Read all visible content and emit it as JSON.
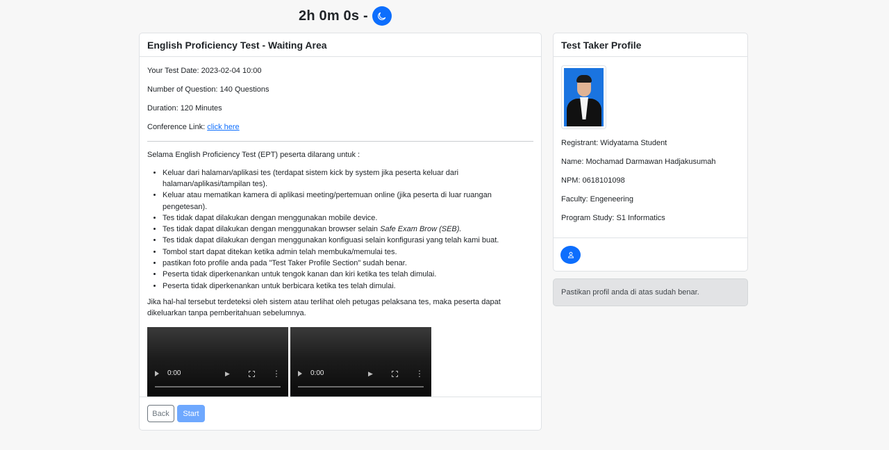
{
  "timer": {
    "text": "2h 0m 0s -"
  },
  "icons": {
    "theme_toggle": "moon-icon",
    "profile_button": "user-icon"
  },
  "colors": {
    "primary": "#0d6efd",
    "start_button": "#6ea8fe",
    "background": "#f7f7f7",
    "alert_background": "#e2e3e5"
  },
  "main": {
    "title": "English Proficiency Test - Waiting Area",
    "test_date": "Your Test Date: 2023-02-04 10:00",
    "questions": "Number of Question: 140 Questions",
    "duration": "Duration: 120 Minutes",
    "conference_label": "Conference Link: ",
    "conference_link": "click here",
    "rules_intro": "Selama English Proficiency Test (EPT) peserta dilarang untuk :",
    "rules": [
      "Keluar dari halaman/aplikasi tes (terdapat sistem kick by system jika peserta keluar dari halaman/aplikasi/tampilan tes).",
      "Keluar atau mematikan kamera di aplikasi meeting/pertemuan online (jika peserta di luar ruangan pengetesan).",
      "Tes tidak dapat dilakukan dengan menggunakan mobile device.",
      "Tes tidak dapat dilakukan dengan menggunakan browser selain ",
      "Tes tidak dapat dilakukan dengan menggunakan konfiguasi selain konfigurasi yang telah kami buat.",
      "Tombol start dapat ditekan ketika admin telah membuka/memulai tes.",
      "pastikan foto profile anda pada \"Test Taker Profile Section\" sudah benar.",
      "Peserta tidak diperkenankan untuk tengok kanan dan kiri ketika tes telah dimulai.",
      "Peserta tidak diperkenankan untuk berbicara ketika tes telah dimulai."
    ],
    "rule_4_emphasis": "Safe Exam Brow (SEB).",
    "closing": "Jika hal-hal tersebut terdeteksi oleh sistem atau terlihat oleh petugas pelaksana tes, maka peserta dapat dikeluarkan tanpa pemberitahuan sebelumnya.",
    "videos": [
      {
        "time": "0:00"
      },
      {
        "time": "0:00"
      }
    ],
    "back_label": "Back",
    "start_label": "Start"
  },
  "profile": {
    "title": "Test Taker Profile",
    "registrant": "Registrant: Widyatama Student",
    "name": "Name: Mochamad Darmawan Hadjakusumah",
    "npm": "NPM: 0618101098",
    "faculty": "Faculty: Engeneering",
    "program": "Program Study: S1 Informatics"
  },
  "alert": {
    "text": "Pastikan profil anda di atas sudah benar."
  }
}
